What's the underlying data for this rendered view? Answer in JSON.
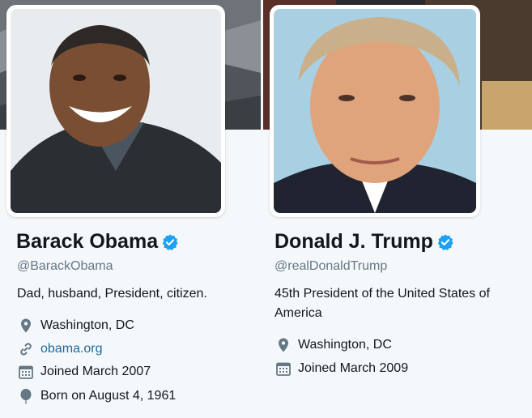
{
  "profiles": [
    {
      "name": "Barack Obama",
      "handle": "@BarackObama",
      "bio": "Dad, husband, President, citizen.",
      "location": "Washington, DC",
      "website": "obama.org",
      "joined": "Joined March 2007",
      "born": "Born on August 4, 1961"
    },
    {
      "name": "Donald J. Trump",
      "handle": "@realDonaldTrump",
      "bio": "45th President of the United States of America",
      "location": "Washington, DC",
      "joined": "Joined March 2009"
    }
  ],
  "colors": {
    "verified": "#1da1f2",
    "link": "#1b6aa0",
    "secondary_text": "#657786",
    "icon": "#657786",
    "background": "#f5f8fa"
  },
  "icons": {
    "verified": "verified-badge-icon",
    "location": "location-pin-icon",
    "website": "link-icon",
    "joined": "calendar-icon",
    "born": "balloon-icon"
  }
}
